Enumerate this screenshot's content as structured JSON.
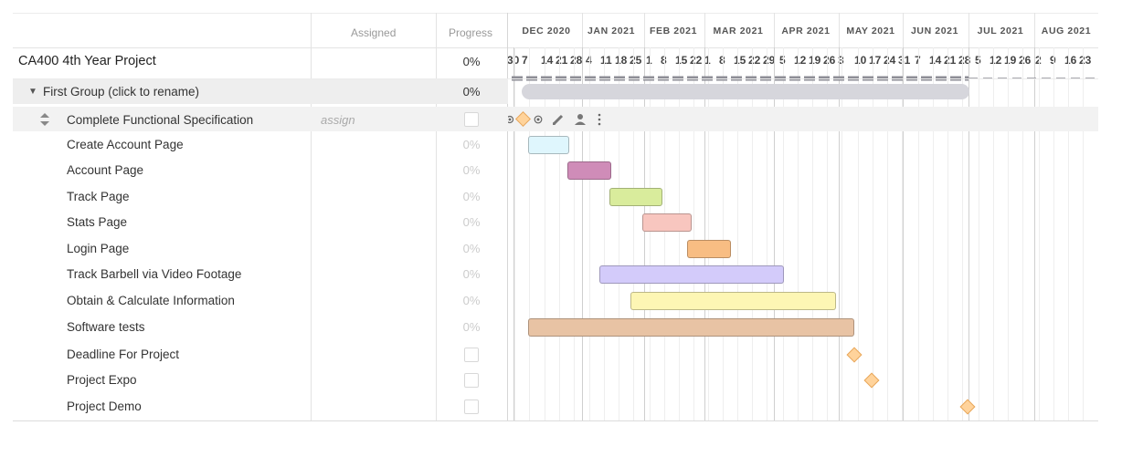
{
  "header": {
    "assigned_label": "Assigned",
    "progress_label": "Progress",
    "months": [
      "DEC 2020",
      "JAN 2021",
      "FEB 2021",
      "MAR 2021",
      "APR 2021",
      "MAY 2021",
      "JUN 2021",
      "JUL 2021",
      "AUG 2021"
    ],
    "days": [
      "30",
      "7",
      "14",
      "21",
      "28",
      "4",
      "11",
      "18",
      "25",
      "1",
      "8",
      "15",
      "22",
      "1",
      "8",
      "15",
      "22",
      "29",
      "5",
      "12",
      "19",
      "26",
      "3",
      "10",
      "17",
      "24",
      "31",
      "7",
      "14",
      "21",
      "28",
      "5",
      "12",
      "19",
      "26",
      "2",
      "9",
      "16",
      "23"
    ]
  },
  "project": {
    "name": "CA400 4th Year Project",
    "progress": "0%"
  },
  "group": {
    "toggle_icon": "▼",
    "name": "First Group (click to rename)",
    "progress": "0%"
  },
  "selected_task": {
    "name": "Complete Functional Specification",
    "assign_placeholder": "assign"
  },
  "tasks": [
    {
      "name": "Create Account Page",
      "progress": "0%",
      "color": "#dff6fd"
    },
    {
      "name": "Account Page",
      "progress": "0%",
      "color": "#cf8cb8"
    },
    {
      "name": "Track Page",
      "progress": "0%",
      "color": "#d9ec9c"
    },
    {
      "name": "Stats Page",
      "progress": "0%",
      "color": "#f8c6bf"
    },
    {
      "name": "Login Page",
      "progress": "0%",
      "color": "#f8bd83"
    },
    {
      "name": "Track Barbell via Video Footage",
      "progress": "0%",
      "color": "#d3cbfa"
    },
    {
      "name": "Obtain & Calculate Information",
      "progress": "0%",
      "color": "#fdf6b4"
    },
    {
      "name": "Software tests",
      "progress": "0%",
      "color": "#e8c3a4"
    }
  ],
  "milestones": [
    {
      "name": "Deadline For Project"
    },
    {
      "name": "Project Expo"
    },
    {
      "name": "Project Demo"
    }
  ],
  "toolbar_icons": [
    "expand-icon",
    "milestone-diamond-icon",
    "target-icon",
    "pencil-icon",
    "person-icon",
    "more-icon"
  ],
  "colors": {
    "group_bar": "#d6d6dc",
    "selected_row": "#f2f2f2",
    "milestone": "#ffd39b"
  }
}
